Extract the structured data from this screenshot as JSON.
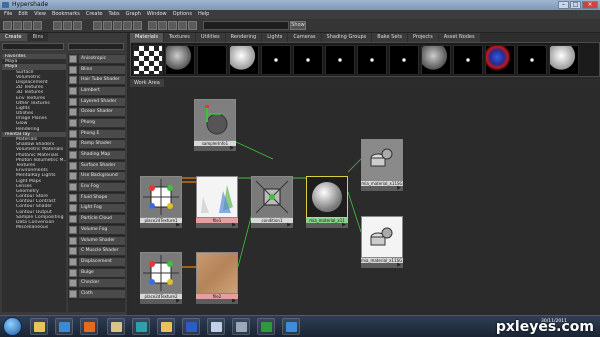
{
  "window": {
    "title": "Hypershade"
  },
  "menubar": [
    "File",
    "Edit",
    "View",
    "Bookmarks",
    "Create",
    "Tabs",
    "Graph",
    "Window",
    "Options",
    "Help"
  ],
  "toolbar": {
    "search_value": "",
    "show_label": "Show"
  },
  "left_tabs": [
    {
      "label": "Create",
      "active": true
    },
    {
      "label": "Bins",
      "active": false
    }
  ],
  "tree": [
    {
      "label": "Favorites",
      "header": true,
      "level": 1
    },
    {
      "label": "Maya",
      "header": false,
      "level": 1
    },
    {
      "label": "Maya",
      "header": true,
      "level": 1
    },
    {
      "label": "Surface",
      "header": false,
      "level": 2
    },
    {
      "label": "Volumetric",
      "header": false,
      "level": 2
    },
    {
      "label": "Displacement",
      "header": false,
      "level": 2
    },
    {
      "label": "2D Textures",
      "header": false,
      "level": 2
    },
    {
      "label": "3D Textures",
      "header": false,
      "level": 2
    },
    {
      "label": "Env Textures",
      "header": false,
      "level": 2
    },
    {
      "label": "Other Textures",
      "header": false,
      "level": 2
    },
    {
      "label": "Lights",
      "header": false,
      "level": 2
    },
    {
      "label": "Utilities",
      "header": false,
      "level": 2
    },
    {
      "label": "Image Planes",
      "header": false,
      "level": 2
    },
    {
      "label": "Glow",
      "header": false,
      "level": 2
    },
    {
      "label": "Rendering",
      "header": false,
      "level": 2
    },
    {
      "label": "mental ray",
      "header": true,
      "level": 1
    },
    {
      "label": "Materials",
      "header": false,
      "level": 2
    },
    {
      "label": "Shadow Shaders",
      "header": false,
      "level": 2
    },
    {
      "label": "Volumetric Materials",
      "header": false,
      "level": 2
    },
    {
      "label": "Photonic Materials",
      "header": false,
      "level": 2
    },
    {
      "label": "Photon Volumetric M...",
      "header": false,
      "level": 2
    },
    {
      "label": "Textures",
      "header": false,
      "level": 2
    },
    {
      "label": "Environments",
      "header": false,
      "level": 2
    },
    {
      "label": "MentalRay Lights",
      "header": false,
      "level": 2
    },
    {
      "label": "Light Maps",
      "header": false,
      "level": 2
    },
    {
      "label": "Lenses",
      "header": false,
      "level": 2
    },
    {
      "label": "Geometry",
      "header": false,
      "level": 2
    },
    {
      "label": "Contour Store",
      "header": false,
      "level": 2
    },
    {
      "label": "Contour Contrast",
      "header": false,
      "level": 2
    },
    {
      "label": "Contour Shader",
      "header": false,
      "level": 2
    },
    {
      "label": "Contour Output",
      "header": false,
      "level": 2
    },
    {
      "label": "Sample Compositing",
      "header": false,
      "level": 2
    },
    {
      "label": "Data Conversion",
      "header": false,
      "level": 2
    },
    {
      "label": "Miscellaneous",
      "header": false,
      "level": 2
    }
  ],
  "node_list": [
    {
      "label": "Anisotropic",
      "icon": "sphere-icon"
    },
    {
      "label": "Blinn",
      "icon": "sphere-icon"
    },
    {
      "label": "Hair Tube Shader",
      "icon": "hair-icon"
    },
    {
      "label": "Lambert",
      "icon": "sphere-icon"
    },
    {
      "label": "Layered Shader",
      "icon": "sphere-icon"
    },
    {
      "label": "Ocean Shader",
      "icon": "sphere-icon"
    },
    {
      "label": "Phong",
      "icon": "sphere-icon"
    },
    {
      "label": "Phong E",
      "icon": "sphere-icon"
    },
    {
      "label": "Ramp Shader",
      "icon": "sphere-icon"
    },
    {
      "label": "Shading Map",
      "icon": "sphere-icon"
    },
    {
      "label": "Surface Shader",
      "icon": "sphere-icon"
    },
    {
      "label": "Use Background",
      "icon": "sphere-icon"
    },
    {
      "label": "Env Fog",
      "icon": "fog-icon"
    },
    {
      "label": "Fluid Shape",
      "icon": "fluid-icon"
    },
    {
      "label": "Light Fog",
      "icon": "fog-icon"
    },
    {
      "label": "Particle Cloud",
      "icon": "cloud-icon"
    },
    {
      "label": "Volume Fog",
      "icon": "fog-icon"
    },
    {
      "label": "Volume Shader",
      "icon": "volume-icon"
    },
    {
      "label": "C Muscle Shader",
      "icon": "muscle-icon"
    },
    {
      "label": "Displacement",
      "icon": "displacement-icon"
    },
    {
      "label": "Bulge",
      "icon": "texture-icon"
    },
    {
      "label": "Checker",
      "icon": "checker-icon"
    },
    {
      "label": "Cloth",
      "icon": "texture-icon"
    }
  ],
  "right_tabs": [
    {
      "label": "Materials",
      "active": true
    },
    {
      "label": "Textures",
      "active": false
    },
    {
      "label": "Utilities",
      "active": false
    },
    {
      "label": "Rendering",
      "active": false
    },
    {
      "label": "Lights",
      "active": false
    },
    {
      "label": "Cameras",
      "active": false
    },
    {
      "label": "Shading Groups",
      "active": false
    },
    {
      "label": "Bake Sets",
      "active": false
    },
    {
      "label": "Projects",
      "active": false
    },
    {
      "label": "Asset Nodes",
      "active": false
    }
  ],
  "swatches": [
    "checker",
    "grey-sphere",
    "black",
    "white-sphere",
    "dot",
    "dot",
    "dot",
    "dot",
    "dot",
    "grey-sphere",
    "dot",
    "red-blue",
    "dot",
    "white-sphere"
  ],
  "work_tab": "Work Area",
  "graph_nodes": [
    {
      "id": "sampler",
      "label": "samplerInfo1",
      "kind": "sampler"
    },
    {
      "id": "place1",
      "label": "place2dTexture1",
      "kind": "place2d"
    },
    {
      "id": "file1",
      "label": "file1",
      "kind": "file-white"
    },
    {
      "id": "cond",
      "label": "condition1",
      "kind": "condition"
    },
    {
      "id": "mia",
      "label": "mia_material_x11",
      "kind": "mia"
    },
    {
      "id": "sg1",
      "label": "mia_material_x11SG",
      "kind": "sg-grey"
    },
    {
      "id": "sg2",
      "label": "mia_material_x11SG1",
      "kind": "sg-white"
    },
    {
      "id": "place2",
      "label": "place2dTexture2",
      "kind": "place2d"
    },
    {
      "id": "file2",
      "label": "file2",
      "kind": "file-wood"
    }
  ],
  "taskbar": {
    "apps": [
      {
        "name": "explorer-icon",
        "color": "#e8c25a"
      },
      {
        "name": "media-player-icon",
        "color": "#3a8ad6"
      },
      {
        "name": "firefox-icon",
        "color": "#e46a1f"
      },
      {
        "name": "wordpad-icon",
        "color": "#d9c48a"
      },
      {
        "name": "maya-icon",
        "color": "#2f9fae"
      },
      {
        "name": "folder-icon",
        "color": "#e8c25a"
      },
      {
        "name": "word-icon",
        "color": "#2a5ec4"
      },
      {
        "name": "notepad-icon",
        "color": "#bfd0e8"
      },
      {
        "name": "hypershade-icon",
        "color": "#9aa9bb"
      },
      {
        "name": "excel-icon",
        "color": "#2f9a3d"
      },
      {
        "name": "photoshop-icon",
        "color": "#3f8cd9"
      }
    ],
    "time": "",
    "date": "30/11/2011",
    "watermark": "pxleyes.com"
  },
  "colors": {
    "selected_border": "#d8d040",
    "connection_orange": "#e38b10",
    "connection_green": "#3ec23e"
  }
}
